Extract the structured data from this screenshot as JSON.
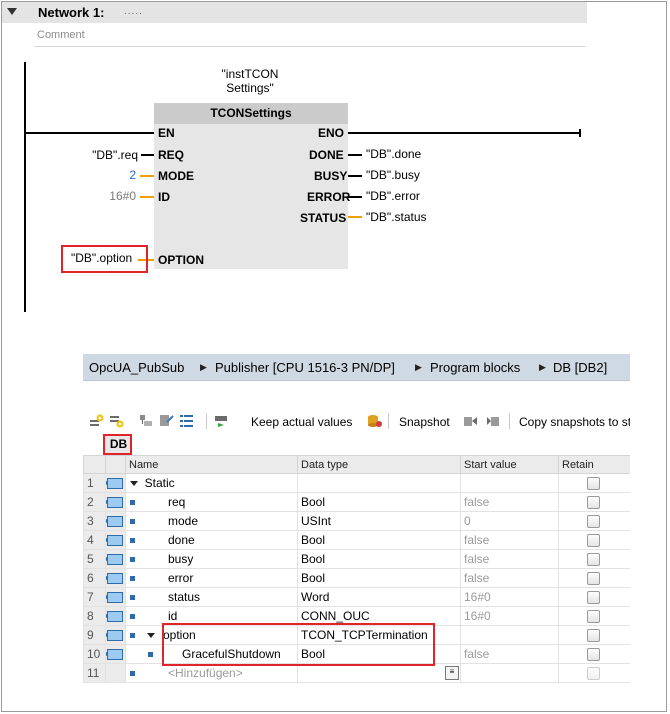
{
  "network": {
    "title": "Network 1:",
    "dots": ".....",
    "comment_placeholder": "Comment"
  },
  "block": {
    "instance_line1": "\"instTCON",
    "instance_line2": "Settings\"",
    "title": "TCONSettings",
    "inputs": [
      {
        "pin": "EN",
        "param": ""
      },
      {
        "pin": "REQ",
        "param": "\"DB\".req"
      },
      {
        "pin": "MODE",
        "param": "2"
      },
      {
        "pin": "ID",
        "param": "16#0"
      },
      {
        "pin": "OPTION",
        "param": "\"DB\".option"
      }
    ],
    "outputs": [
      {
        "pin": "ENO",
        "param": ""
      },
      {
        "pin": "DONE",
        "param": "\"DB\".done"
      },
      {
        "pin": "BUSY",
        "param": "\"DB\".busy"
      },
      {
        "pin": "ERROR",
        "param": "\"DB\".error"
      },
      {
        "pin": "STATUS",
        "param": "\"DB\".status"
      }
    ]
  },
  "db_window": {
    "breadcrumb": [
      "OpcUA_PubSub",
      "Publisher [CPU 1516-3 PN/DP]",
      "Program blocks",
      "DB [DB2]"
    ],
    "toolbar": {
      "keep_actual_values": "Keep actual values",
      "snapshot": "Snapshot",
      "copy_snapshots": "Copy snapshots to st"
    },
    "db_name": "DB",
    "columns": [
      "Name",
      "Data type",
      "Start value",
      "Retain"
    ],
    "rows": [
      {
        "num": "1",
        "name": "Static",
        "type": "",
        "start": ""
      },
      {
        "num": "2",
        "name": "req",
        "type": "Bool",
        "start": "false"
      },
      {
        "num": "3",
        "name": "mode",
        "type": "USInt",
        "start": "0"
      },
      {
        "num": "4",
        "name": "done",
        "type": "Bool",
        "start": "false"
      },
      {
        "num": "5",
        "name": "busy",
        "type": "Bool",
        "start": "false"
      },
      {
        "num": "6",
        "name": "error",
        "type": "Bool",
        "start": "false"
      },
      {
        "num": "7",
        "name": "status",
        "type": "Word",
        "start": "16#0"
      },
      {
        "num": "8",
        "name": "id",
        "type": "CONN_OUC",
        "start": "16#0"
      },
      {
        "num": "9",
        "name": "option",
        "type": "TCON_TCPTermination",
        "start": ""
      },
      {
        "num": "10",
        "name": "GracefulShutdown",
        "type": "Bool",
        "start": "false"
      },
      {
        "num": "11",
        "name": "<Hinzufügen>",
        "type": "",
        "start": ""
      }
    ]
  },
  "colors": {
    "highlight": "#e1232b",
    "wire_param": "#f0a000",
    "breadcrumb_bg": "#cfd9e3",
    "constant_blue": "#3366cc"
  }
}
